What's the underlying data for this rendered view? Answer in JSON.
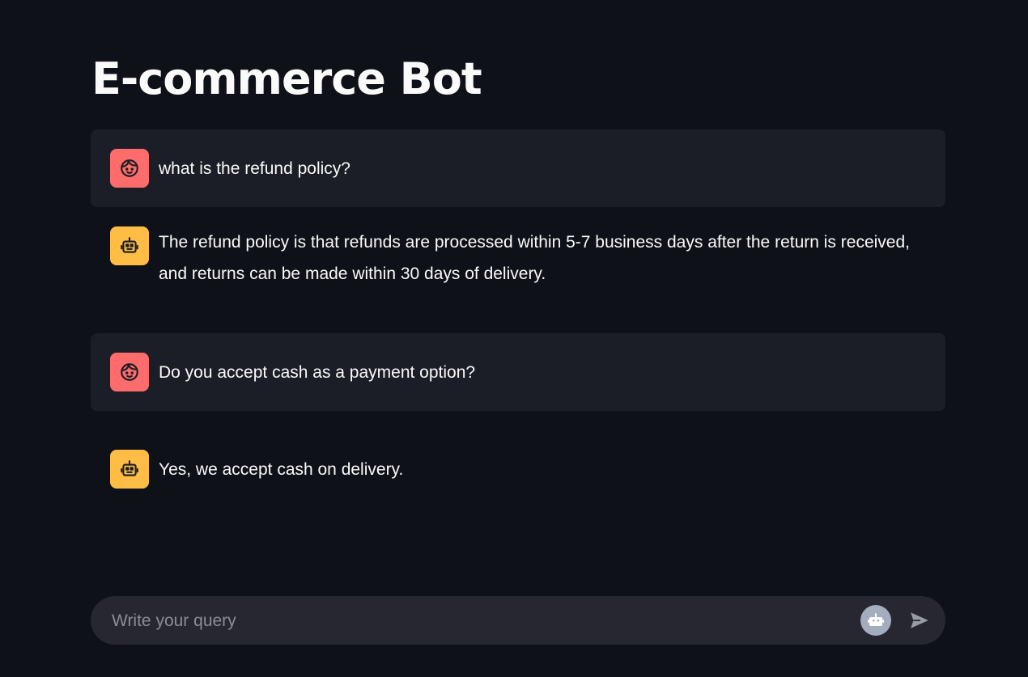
{
  "header": {
    "title": "E-commerce Bot"
  },
  "chat": {
    "messages": [
      {
        "role": "user",
        "avatar_icon": "user-face-icon",
        "text": "what is the refund policy?"
      },
      {
        "role": "assistant",
        "avatar_icon": "robot-icon",
        "text": "The refund policy is that refunds are processed within 5-7 business days after the return is received, and returns can be made within 30 days of delivery."
      },
      {
        "role": "user",
        "avatar_icon": "user-face-icon",
        "text": "Do you accept cash as a payment option?"
      },
      {
        "role": "assistant",
        "avatar_icon": "robot-icon",
        "text": "Yes, we accept cash on delivery."
      }
    ]
  },
  "input": {
    "placeholder": "Write your query",
    "value": "",
    "send_icon": "send-icon",
    "bot_icon": "robot-icon"
  },
  "colors": {
    "background": "#0e1117",
    "user_bubble": "#1b1e26",
    "user_avatar": "#ff6c6c",
    "assistant_avatar": "#ffbd45",
    "input_background": "#262730",
    "text": "#fafafa",
    "placeholder": "#8b8d95"
  }
}
